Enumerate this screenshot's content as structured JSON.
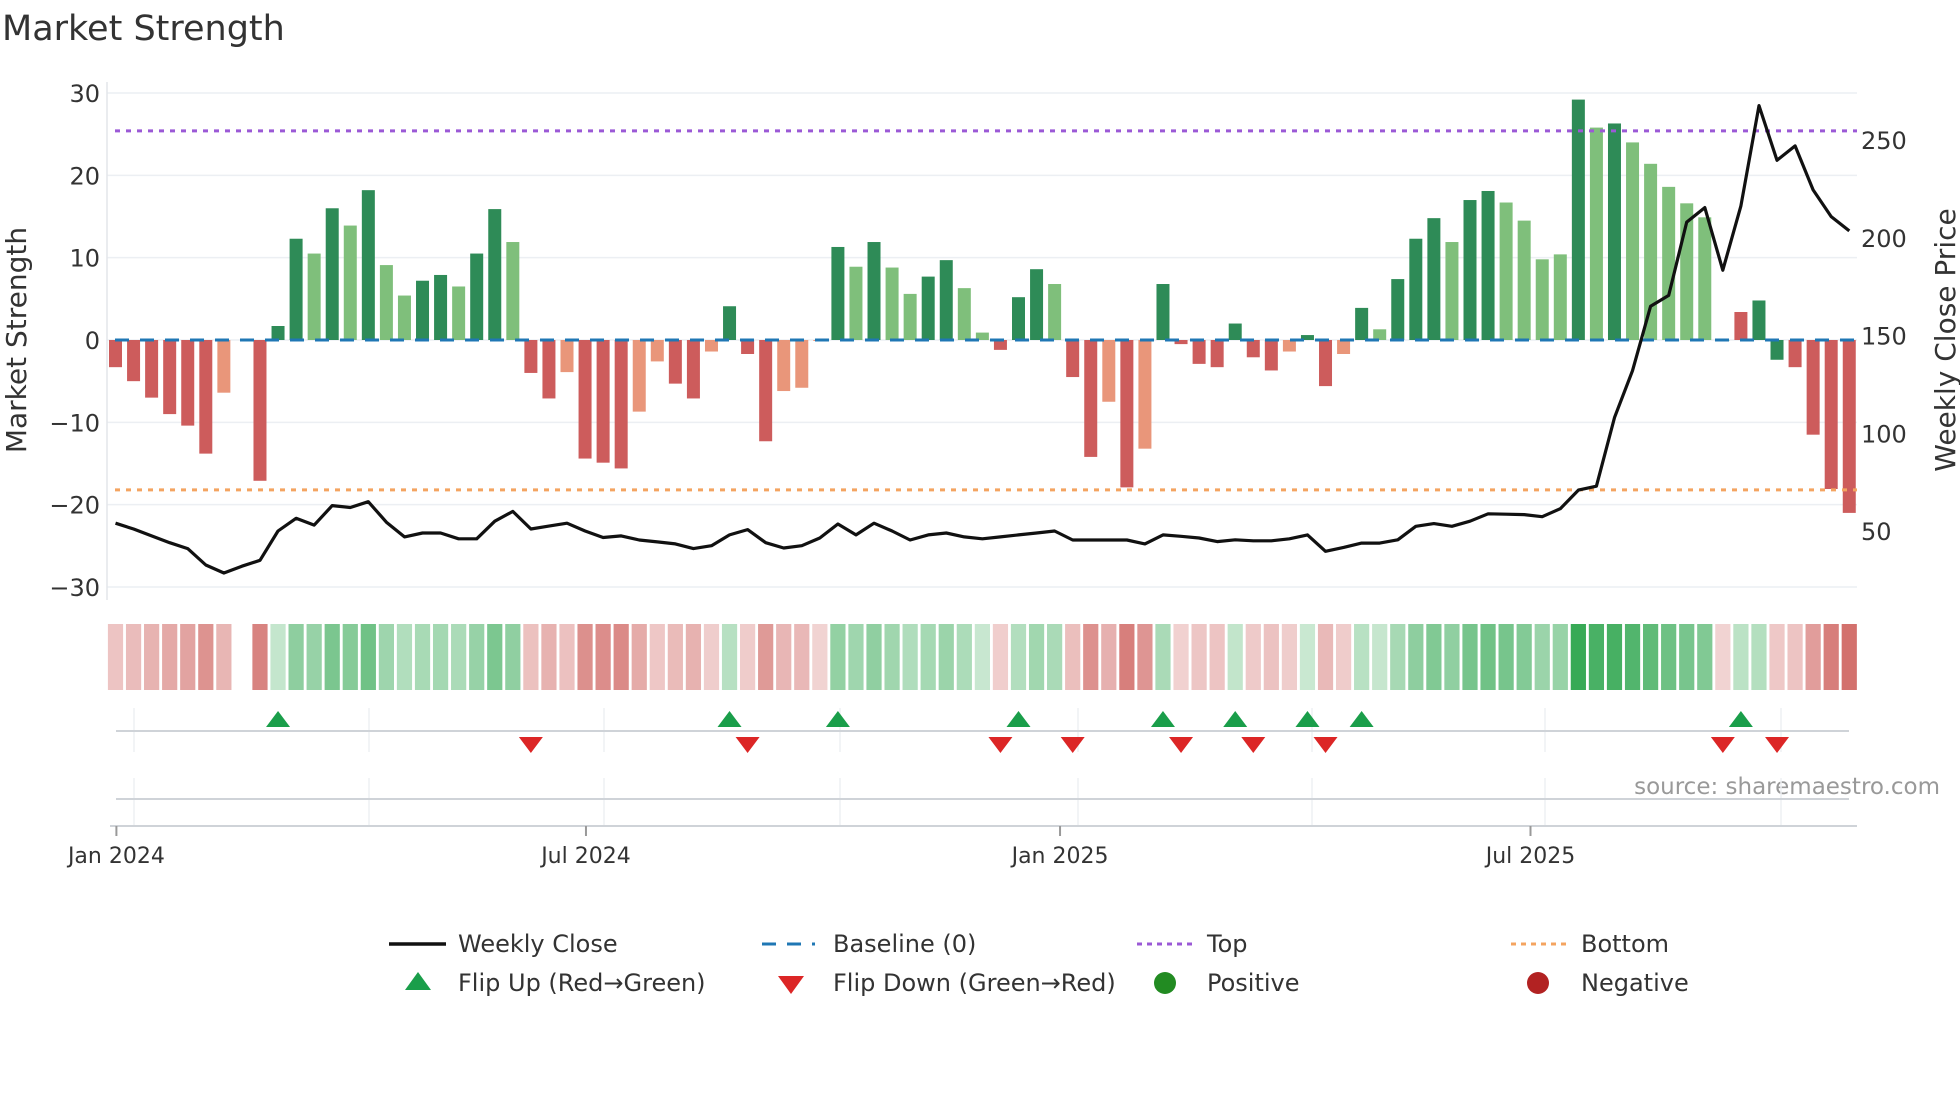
{
  "chart_data": {
    "type": "bar",
    "title": "Market Strength",
    "ylabel": "Market Strength",
    "y2label": "Weekly Close Price",
    "ylim": [
      -31.5,
      31.5
    ],
    "y2lim": [
      20,
      275
    ],
    "y_ticks": [
      "30",
      "20",
      "10",
      "0",
      "−10",
      "−20",
      "−30"
    ],
    "y_tick_values": [
      30,
      20,
      10,
      0,
      -10,
      -20,
      -30
    ],
    "y2_ticks": [
      "250",
      "200",
      "150",
      "100",
      "50"
    ],
    "y2_tick_values": [
      250,
      200,
      150,
      100,
      50
    ],
    "x_ticks": [
      "Jan 2024",
      "Jul 2024",
      "Jan 2025",
      "Jul 2025"
    ],
    "x_tick_weeks": [
      1.05,
      27.05,
      53.3,
      79.35
    ],
    "top_level": 25.4,
    "bottom_level": -18.2,
    "strength": [
      -3.3,
      -5.0,
      -7.0,
      -9.0,
      -10.4,
      -13.8,
      -6.4,
      null,
      -17.1,
      1.7,
      12.3,
      10.5,
      16.0,
      13.9,
      18.2,
      9.1,
      5.4,
      7.2,
      7.9,
      6.5,
      10.5,
      15.9,
      11.9,
      -4.0,
      -7.1,
      -3.9,
      -14.4,
      -14.9,
      -15.6,
      -8.7,
      -2.6,
      -5.3,
      -7.1,
      -1.4,
      4.1,
      -1.7,
      -12.3,
      -6.2,
      -5.8,
      -0.1,
      11.3,
      8.9,
      11.9,
      8.8,
      5.6,
      7.7,
      9.7,
      6.3,
      0.9,
      -1.2,
      5.2,
      8.6,
      6.8,
      -4.5,
      -14.2,
      -7.5,
      -17.9,
      -13.2,
      6.8,
      -0.5,
      -2.9,
      -3.3,
      2.0,
      -2.1,
      -3.7,
      -1.4,
      0.6,
      -5.6,
      -1.7,
      3.9,
      1.3,
      7.4,
      12.3,
      14.8,
      11.9,
      17.0,
      18.1,
      16.7,
      14.5,
      9.8,
      10.4,
      29.2,
      25.8,
      26.3,
      24.0,
      21.4,
      18.6,
      16.6,
      14.9,
      -0.1,
      3.4,
      4.8,
      -2.4,
      -3.3,
      -11.5,
      -18.1,
      -21.0
    ],
    "shade": "RRRRRRr-RGGgGgGggGGgGGgRRrRRRrrRRrGRRrrrGgGggGGggRGGgRRrRrGRRRGRRrGRrGgGGGgGGggggGgGggggggRGGRRRRR",
    "weekly_close": [
      54,
      51,
      47.5,
      44,
      41,
      32.6,
      28.5,
      32,
      35,
      50,
      56.5,
      53,
      63,
      62,
      65,
      54.5,
      47,
      49,
      49,
      46,
      46,
      55,
      60,
      51,
      52.5,
      54,
      50,
      46.7,
      47.5,
      45.4,
      44.4,
      43.4,
      41,
      42.5,
      48,
      50.7,
      44,
      41.3,
      42.5,
      46.4,
      53.6,
      48,
      54,
      50,
      45.4,
      48,
      49,
      47,
      46,
      47,
      48,
      49,
      50,
      45.4,
      45.4,
      45.4,
      45.4,
      43.4,
      48,
      47.3,
      46.4,
      44.6,
      45.5,
      45,
      45,
      46,
      48,
      39.6,
      41.6,
      43.8,
      43.8,
      45.5,
      52.4,
      53.8,
      52.4,
      55,
      58.8,
      58.6,
      58.4,
      57.3,
      61.4,
      70.9,
      72.9,
      108,
      132,
      165,
      170.5,
      208,
      215.4,
      183.4,
      216.3,
      267.6,
      239.6,
      247,
      224.5,
      210.8,
      203.5
    ],
    "flip_up_weeks": [
      10,
      35,
      41,
      51,
      59,
      63,
      67,
      70,
      91
    ],
    "flip_down_weeks": [
      24,
      36,
      50,
      54,
      60,
      64,
      68,
      90,
      93
    ],
    "legend": {
      "weekly_close": "Weekly Close",
      "baseline": "Baseline (0)",
      "top": "Top",
      "bottom": "Bottom",
      "flip_up": "Flip Up (Red→Green)",
      "flip_down": "Flip Down (Green→Red)",
      "positive": "Positive",
      "negative": "Negative"
    },
    "legend_placement": "bottom-center",
    "grid": true,
    "colors": {
      "strong_green": "#2e8b57",
      "weak_green": "#7fbf7b",
      "strong_red": "#cd5c5c",
      "weak_red": "#e9967a",
      "close": "#111111",
      "baseline": "#1f77b4",
      "top": "#9b59d6",
      "bottom": "#f4a460",
      "flip_up": "#1a9e4a",
      "flip_down": "#dc2626",
      "positive": "#228b22",
      "negative": "#b22222"
    }
  },
  "source": "source: sharemaestro.com"
}
